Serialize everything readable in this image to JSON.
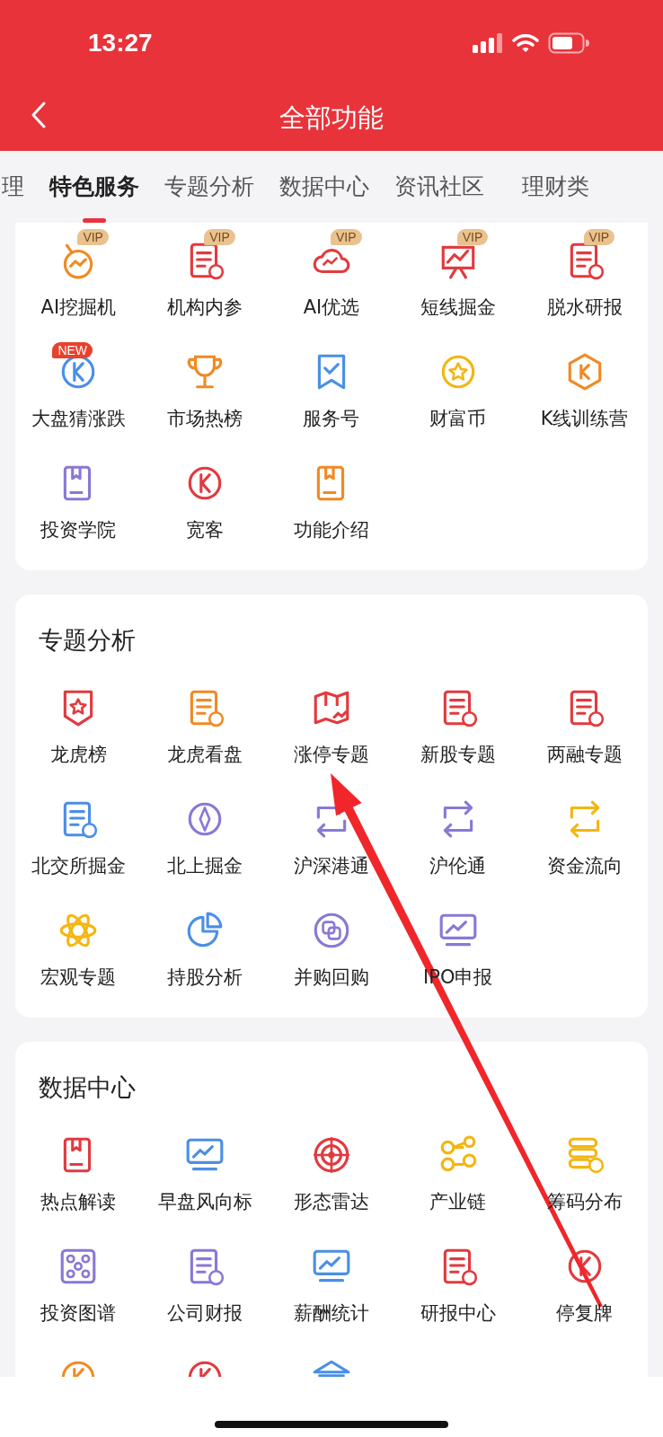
{
  "status_bar": {
    "time": "13:27"
  },
  "header": {
    "title": "全部功能"
  },
  "tabs": [
    {
      "label": "理",
      "selected": false
    },
    {
      "label": "特色服务",
      "selected": true
    },
    {
      "label": "专题分析",
      "selected": false
    },
    {
      "label": "数据中心",
      "selected": false
    },
    {
      "label": "资讯社区",
      "selected": false
    },
    {
      "label": "理财类",
      "selected": false
    }
  ],
  "sections": [
    {
      "items": [
        {
          "kind": "tile",
          "label": "AI挖掘机",
          "badge": "VIP"
        },
        {
          "kind": "tile",
          "label": "机构内参",
          "badge": "VIP"
        },
        {
          "kind": "tile",
          "label": "AI优选",
          "badge": "VIP"
        },
        {
          "kind": "tile",
          "label": "短线掘金",
          "badge": "VIP"
        },
        {
          "kind": "tile",
          "label": "脱水研报",
          "badge": "VIP"
        },
        {
          "kind": "tile",
          "label": "大盘猜涨跌",
          "badge": "NEW"
        },
        {
          "kind": "tile",
          "label": "市场热榜"
        },
        {
          "kind": "tile",
          "label": "服务号"
        },
        {
          "kind": "tile",
          "label": "财富币"
        },
        {
          "kind": "tile",
          "label": "K线训练营"
        },
        {
          "kind": "tile",
          "label": "投资学院"
        },
        {
          "kind": "tile",
          "label": "宽客"
        },
        {
          "kind": "tile",
          "label": "功能介绍"
        }
      ]
    },
    {
      "title": "专题分析",
      "items": [
        {
          "kind": "tile",
          "label": "龙虎榜"
        },
        {
          "kind": "tile",
          "label": "龙虎看盘"
        },
        {
          "kind": "tile",
          "label": "涨停专题"
        },
        {
          "kind": "tile",
          "label": "新股专题"
        },
        {
          "kind": "tile",
          "label": "两融专题"
        },
        {
          "kind": "tile",
          "label": "北交所掘金"
        },
        {
          "kind": "tile",
          "label": "北上掘金"
        },
        {
          "kind": "tile",
          "label": "沪深港通"
        },
        {
          "kind": "tile",
          "label": "沪伦通"
        },
        {
          "kind": "tile",
          "label": "资金流向"
        },
        {
          "kind": "tile",
          "label": "宏观专题"
        },
        {
          "kind": "tile",
          "label": "持股分析"
        },
        {
          "kind": "tile",
          "label": "并购回购"
        },
        {
          "kind": "tile",
          "label": "IPO申报"
        }
      ]
    },
    {
      "title": "数据中心",
      "items": [
        {
          "kind": "tile",
          "label": "热点解读"
        },
        {
          "kind": "tile",
          "label": "早盘风向标"
        },
        {
          "kind": "tile",
          "label": "形态雷达"
        },
        {
          "kind": "tile",
          "label": "产业链"
        },
        {
          "kind": "tile",
          "label": "筹码分布"
        },
        {
          "kind": "tile",
          "label": "投资图谱"
        },
        {
          "kind": "tile",
          "label": "公司财报"
        },
        {
          "kind": "tile",
          "label": "薪酬统计"
        },
        {
          "kind": "tile",
          "label": "研报中心"
        },
        {
          "kind": "tile",
          "label": "停复牌"
        },
        {
          "kind": "cut"
        },
        {
          "kind": "cut"
        },
        {
          "kind": "cut"
        }
      ]
    }
  ],
  "annotations": [
    {
      "kind": "arrow"
    }
  ]
}
